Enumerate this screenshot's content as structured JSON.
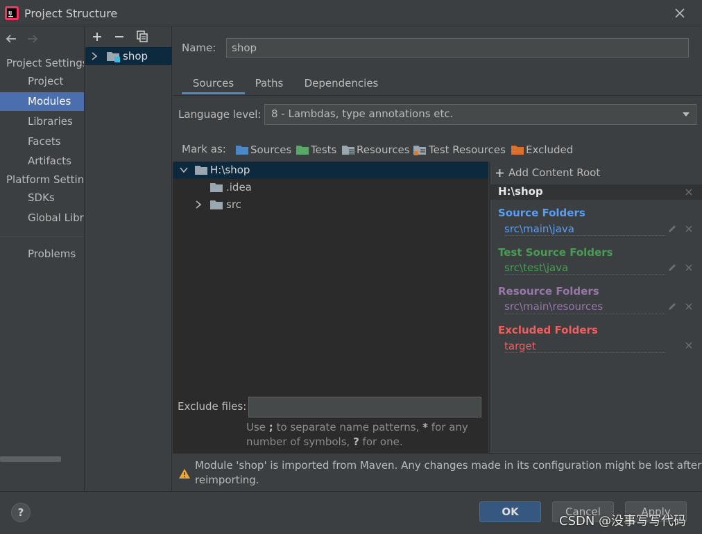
{
  "window": {
    "title": "Project Structure",
    "app_icon": "intellij-idea-icon",
    "close_icon": "close-icon"
  },
  "nav": {
    "back_icon": "arrow-left-icon",
    "forward_icon": "arrow-right-icon",
    "section_project": "Project Settings",
    "project_items": [
      "Project",
      "Modules",
      "Libraries",
      "Facets",
      "Artifacts"
    ],
    "section_platform": "Platform Settings",
    "platform_items": [
      "SDKs",
      "Global Libraries"
    ],
    "problems": "Problems",
    "selected": "Modules"
  },
  "modules": {
    "add_icon": "plus-icon",
    "remove_icon": "minus-icon",
    "copy_icon": "copy-icon",
    "items": [
      {
        "name": "shop",
        "icon": "module-folder-icon"
      }
    ]
  },
  "detail": {
    "name_label": "Name:",
    "name_value": "shop",
    "tabs": [
      "Sources",
      "Paths",
      "Dependencies"
    ],
    "active_tab": "Sources",
    "language_label": "Language level:",
    "language_value": "8 - Lambdas, type annotations etc.",
    "mark_as_label": "Mark as:",
    "mark_as": [
      {
        "label": "Sources",
        "color": "#4a88c7"
      },
      {
        "label": "Tests",
        "color": "#59a869"
      },
      {
        "label": "Resources",
        "color": "#9aa7b0"
      },
      {
        "label": "Test Resources",
        "color": "#9aa7b0"
      },
      {
        "label": "Excluded",
        "color": "#d9702b"
      }
    ]
  },
  "tree": {
    "root": "H:\\shop",
    "children": [
      ".idea",
      "src"
    ]
  },
  "roots_panel": {
    "add_label": "Add Content Root",
    "root_path": "H:\\shop",
    "groups": [
      {
        "heading": "Source Folders",
        "path": "src\\main\\java",
        "color": "#589df6"
      },
      {
        "heading": "Test Source Folders",
        "path": "src\\test\\java",
        "color": "#499c54"
      },
      {
        "heading": "Resource Folders",
        "path": "src\\main\\resources",
        "color": "#9876aa"
      },
      {
        "heading": "Excluded Folders",
        "path": "target",
        "color": "#f55c5c"
      }
    ]
  },
  "exclude": {
    "label": "Exclude files:",
    "hint_1a": "Use ",
    "hint_1b": ";",
    "hint_1c": " to separate name patterns, ",
    "hint_1d": "*",
    "hint_1e": " for any",
    "hint_2a": "number of symbols, ",
    "hint_2b": "?",
    "hint_2c": " for one."
  },
  "warning": {
    "icon": "warning-triangle-icon",
    "line1": "Module 'shop' is imported from Maven. Any changes made in its configuration might be lost after",
    "line2": "reimporting."
  },
  "buttons": {
    "help": "?",
    "ok": "OK",
    "cancel": "Cancel",
    "apply": "Apply"
  },
  "watermark": "CSDN @没事写写代码"
}
